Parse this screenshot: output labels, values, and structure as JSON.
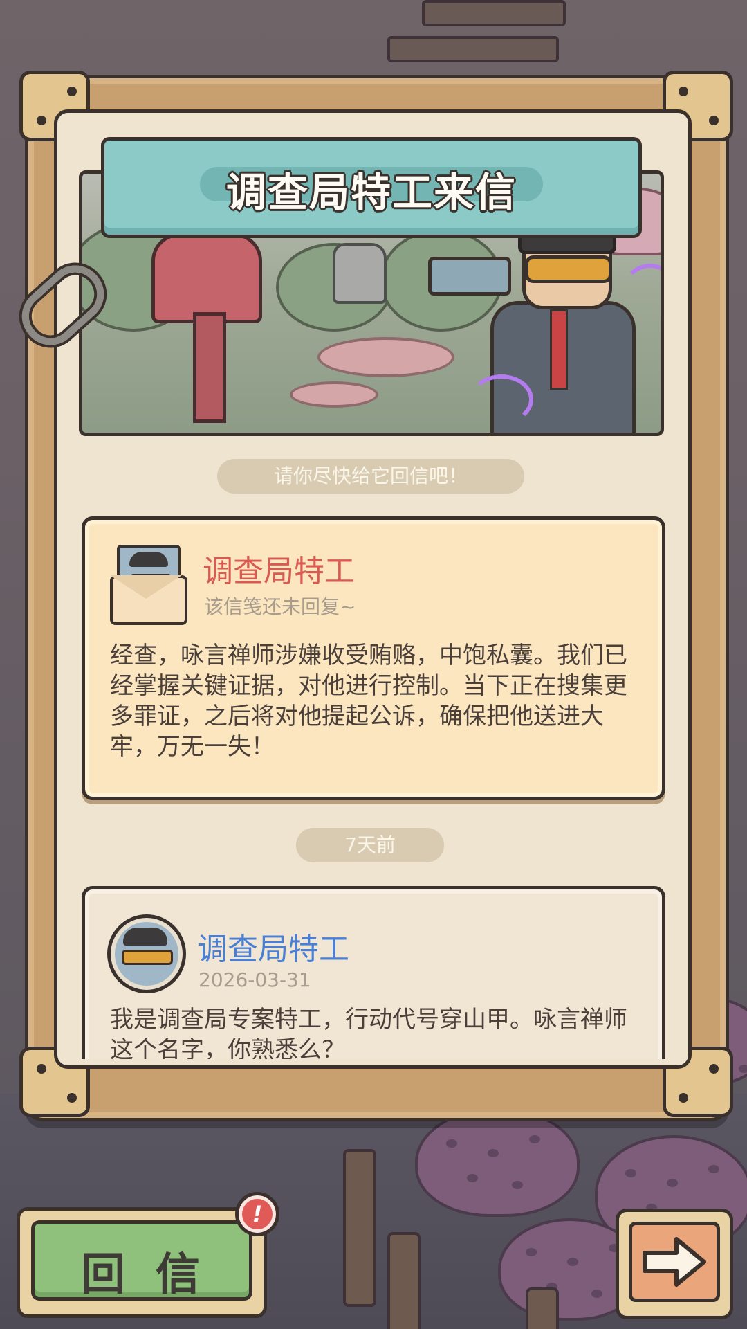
{
  "title": "调查局特工来信",
  "hint": "请你尽快给它回信吧！",
  "letters": [
    {
      "sender": "调查局特工",
      "status": "该信笺还未回复~",
      "body": "经查，咏言禅师涉嫌收受贿赂，中饱私囊。我们已经掌握关键证据，对他进行控制。当下正在搜集更多罪证，之后将对他提起公诉，确保把他送进大牢，万无一失！"
    },
    {
      "sender": "调查局特工",
      "date": "2026-03-31",
      "body": "我是调查局专案特工，行动代号穿山甲。咏言禅师这个名字，你熟悉么？"
    }
  ],
  "time_ago": "7天前",
  "buttons": {
    "reply_label": "回信",
    "reply_badge": "!",
    "next_icon": "arrow-right-icon"
  },
  "colors": {
    "title_banner": "#8ccac8",
    "unread_sender": "#d85a52",
    "read_sender": "#4a7fd6",
    "reply_button": "#8fc07c",
    "next_button": "#eba57a",
    "badge": "#e05a58"
  }
}
